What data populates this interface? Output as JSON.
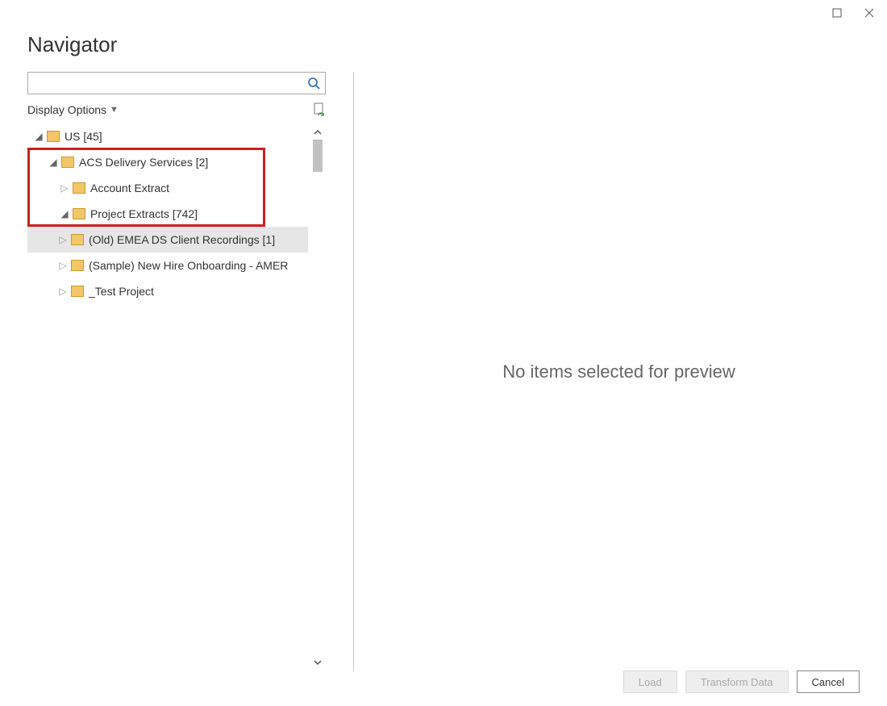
{
  "title": "Navigator",
  "displayOptionsLabel": "Display Options",
  "previewMessage": "No items selected for preview",
  "search": {
    "placeholder": ""
  },
  "tree": [
    {
      "label": "US [45]"
    },
    {
      "label": "ACS Delivery Services [2]"
    },
    {
      "label": "Account Extract"
    },
    {
      "label": "Project Extracts [742]"
    },
    {
      "label": "(Old) EMEA DS Client Recordings [1]"
    },
    {
      "label": "(Sample) New Hire Onboarding - AMER"
    },
    {
      "label": "_Test Project"
    }
  ],
  "buttons": {
    "load": "Load",
    "transform": "Transform Data",
    "cancel": "Cancel"
  }
}
